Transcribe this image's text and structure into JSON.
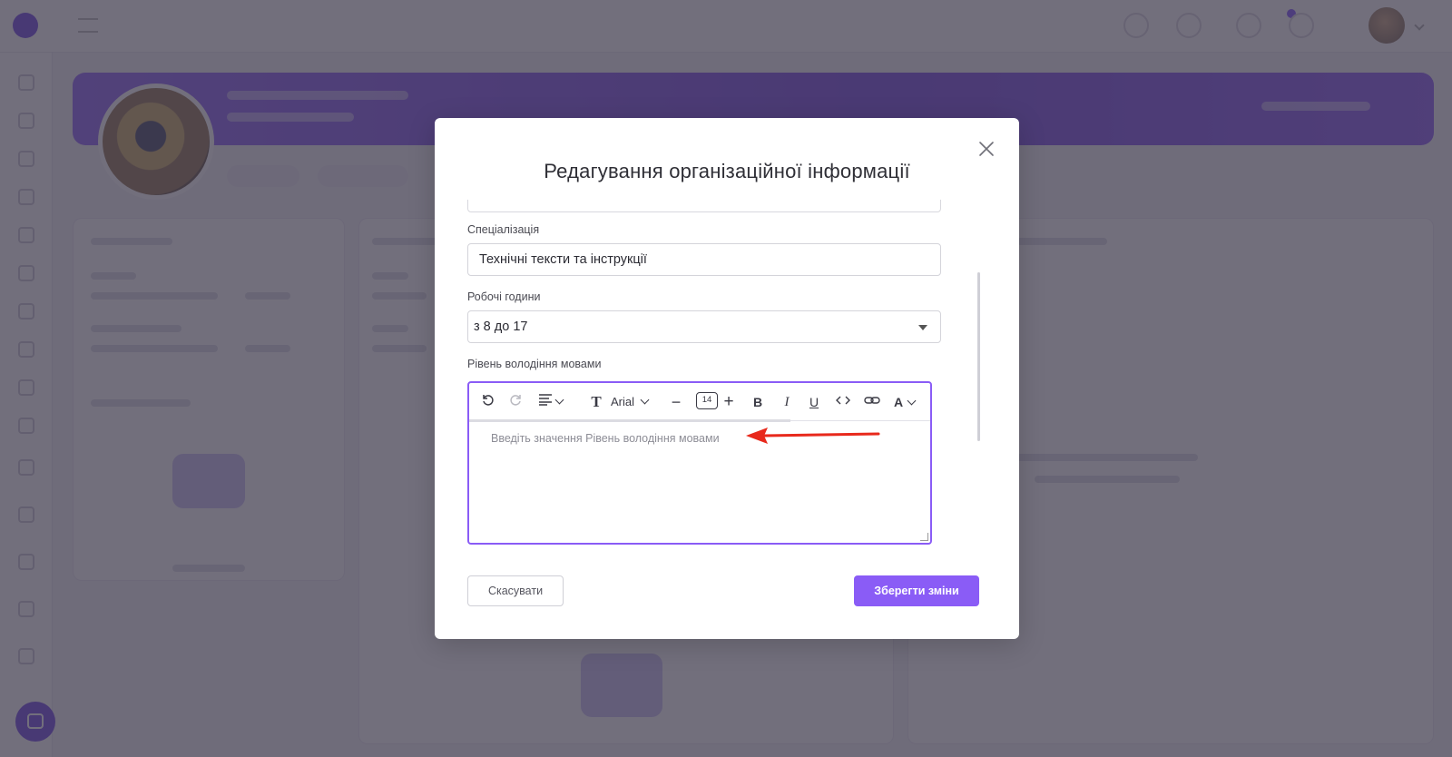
{
  "modal": {
    "title": "Редагування організаційної інформації",
    "close_icon": "close-icon",
    "fields": {
      "specialization": {
        "label": "Спеціалізація",
        "value": "Технічні тексти та інструкції"
      },
      "working_hours": {
        "label": "Робочі години",
        "value": "з 8 до 17"
      },
      "language_level": {
        "label": "Рівень володіння мовами",
        "placeholder": "Введіть значення Рівень володіння мовами"
      }
    },
    "editor_toolbar": {
      "undo_icon": "undo-icon",
      "redo_icon": "redo-icon",
      "align_icon": "align-icon",
      "font_icon": "text-t-icon",
      "font_family": "Arial",
      "decrease_size": "−",
      "font_size": "14",
      "increase_size": "+",
      "bold": "B",
      "italic": "I",
      "underline": "U",
      "code_icon": "code-icon",
      "link_icon": "link-icon",
      "text_color": "A"
    },
    "buttons": {
      "cancel": "Скасувати",
      "save": "Зберегти зміни"
    }
  },
  "colors": {
    "accent": "#8a5cf6",
    "annotation_arrow": "#e8291c",
    "overlay": "#3c384a"
  }
}
